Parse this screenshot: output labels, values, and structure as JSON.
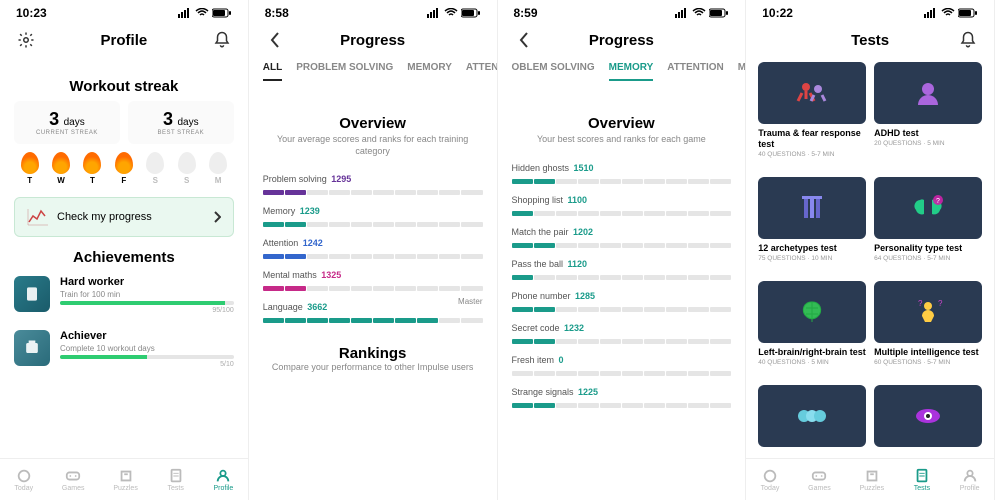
{
  "colors": {
    "teal": "#1a9b8a",
    "purple": "#663399",
    "blue": "#3366cc",
    "magenta": "#c62a88",
    "green": "#2ecc71"
  },
  "screen1": {
    "time": "10:23",
    "title": "Profile",
    "streak_title": "Workout streak",
    "current": {
      "num": "3",
      "unit": "days",
      "label": "CURRENT STREAK"
    },
    "best": {
      "num": "3",
      "unit": "days",
      "label": "BEST STREAK"
    },
    "days": [
      {
        "letter": "T",
        "on": true
      },
      {
        "letter": "W",
        "on": true
      },
      {
        "letter": "T",
        "on": true
      },
      {
        "letter": "F",
        "on": true
      },
      {
        "letter": "S",
        "on": false
      },
      {
        "letter": "S",
        "on": false
      },
      {
        "letter": "M",
        "on": false
      }
    ],
    "check_progress": "Check my progress",
    "achievements_title": "Achievements",
    "ach": [
      {
        "title": "Hard worker",
        "sub": "Train for 100 min",
        "fill": 95,
        "count": "95/100"
      },
      {
        "title": "Achiever",
        "sub": "Complete 10 workout days",
        "fill": 50,
        "count": "5/10"
      }
    ],
    "tabbar": [
      "Today",
      "Games",
      "Puzzles",
      "Tests",
      "Profile"
    ],
    "active_tab": 4
  },
  "screen2": {
    "time": "8:58",
    "title": "Progress",
    "tabs": [
      "ALL",
      "PROBLEM SOLVING",
      "MEMORY",
      "ATTENTION"
    ],
    "active_tab": 0,
    "overview": "Overview",
    "sub": "Your average scores and ranks for each training category",
    "rows": [
      {
        "label": "Problem solving",
        "val": "1295",
        "color": "#663399",
        "segsOn": 2
      },
      {
        "label": "Memory",
        "val": "1239",
        "color": "#1a9b8a",
        "segsOn": 2
      },
      {
        "label": "Attention",
        "val": "1242",
        "color": "#3366cc",
        "segsOn": 2
      },
      {
        "label": "Mental maths",
        "val": "1325",
        "color": "#c62a88",
        "segsOn": 2
      },
      {
        "label": "Language",
        "val": "3662",
        "color": "#1a9b8a",
        "segsOn": 8,
        "badge": "Master"
      }
    ],
    "rankings": "Rankings",
    "rankings_sub": "Compare your performance to other Impulse users"
  },
  "screen3": {
    "time": "8:59",
    "title": "Progress",
    "tabs": [
      "OBLEM SOLVING",
      "MEMORY",
      "ATTENTION",
      "MENTAL MA"
    ],
    "active_tab": 1,
    "overview": "Overview",
    "sub": "Your best scores and ranks for each game",
    "rows": [
      {
        "label": "Hidden ghosts",
        "val": "1510",
        "segsOn": 2
      },
      {
        "label": "Shopping list",
        "val": "1100",
        "segsOn": 1
      },
      {
        "label": "Match the pair",
        "val": "1202",
        "segsOn": 2
      },
      {
        "label": "Pass the ball",
        "val": "1120",
        "segsOn": 1
      },
      {
        "label": "Phone number",
        "val": "1285",
        "segsOn": 2
      },
      {
        "label": "Secret code",
        "val": "1232",
        "segsOn": 2
      },
      {
        "label": "Fresh item",
        "val": "0",
        "segsOn": 0
      },
      {
        "label": "Strange signals",
        "val": "1225",
        "segsOn": 2
      }
    ]
  },
  "screen4": {
    "time": "10:22",
    "title": "Tests",
    "tests": [
      {
        "title": "Trauma & fear response test",
        "meta": "40 QUESTIONS · 5-7 MIN",
        "icon": "wrestle"
      },
      {
        "title": "ADHD test",
        "meta": "20 QUESTIONS · 5 MIN",
        "icon": "bust"
      },
      {
        "title": "12 archetypes test",
        "meta": "75 QUESTIONS · 10 MIN",
        "icon": "columns"
      },
      {
        "title": "Personality type test",
        "meta": "64 QUESTIONS · 5-7 MIN",
        "icon": "brains"
      },
      {
        "title": "Left-brain/right-brain test",
        "meta": "40 QUESTIONS · 5 MIN",
        "icon": "brain"
      },
      {
        "title": "Multiple intelligence test",
        "meta": "60 QUESTIONS · 5-7 MIN",
        "icon": "meditate"
      },
      {
        "title": "",
        "meta": "",
        "icon": "faces"
      },
      {
        "title": "",
        "meta": "",
        "icon": "eye"
      }
    ],
    "tabbar": [
      "Today",
      "Games",
      "Puzzles",
      "Tests",
      "Profile"
    ],
    "active_tab": 3
  }
}
